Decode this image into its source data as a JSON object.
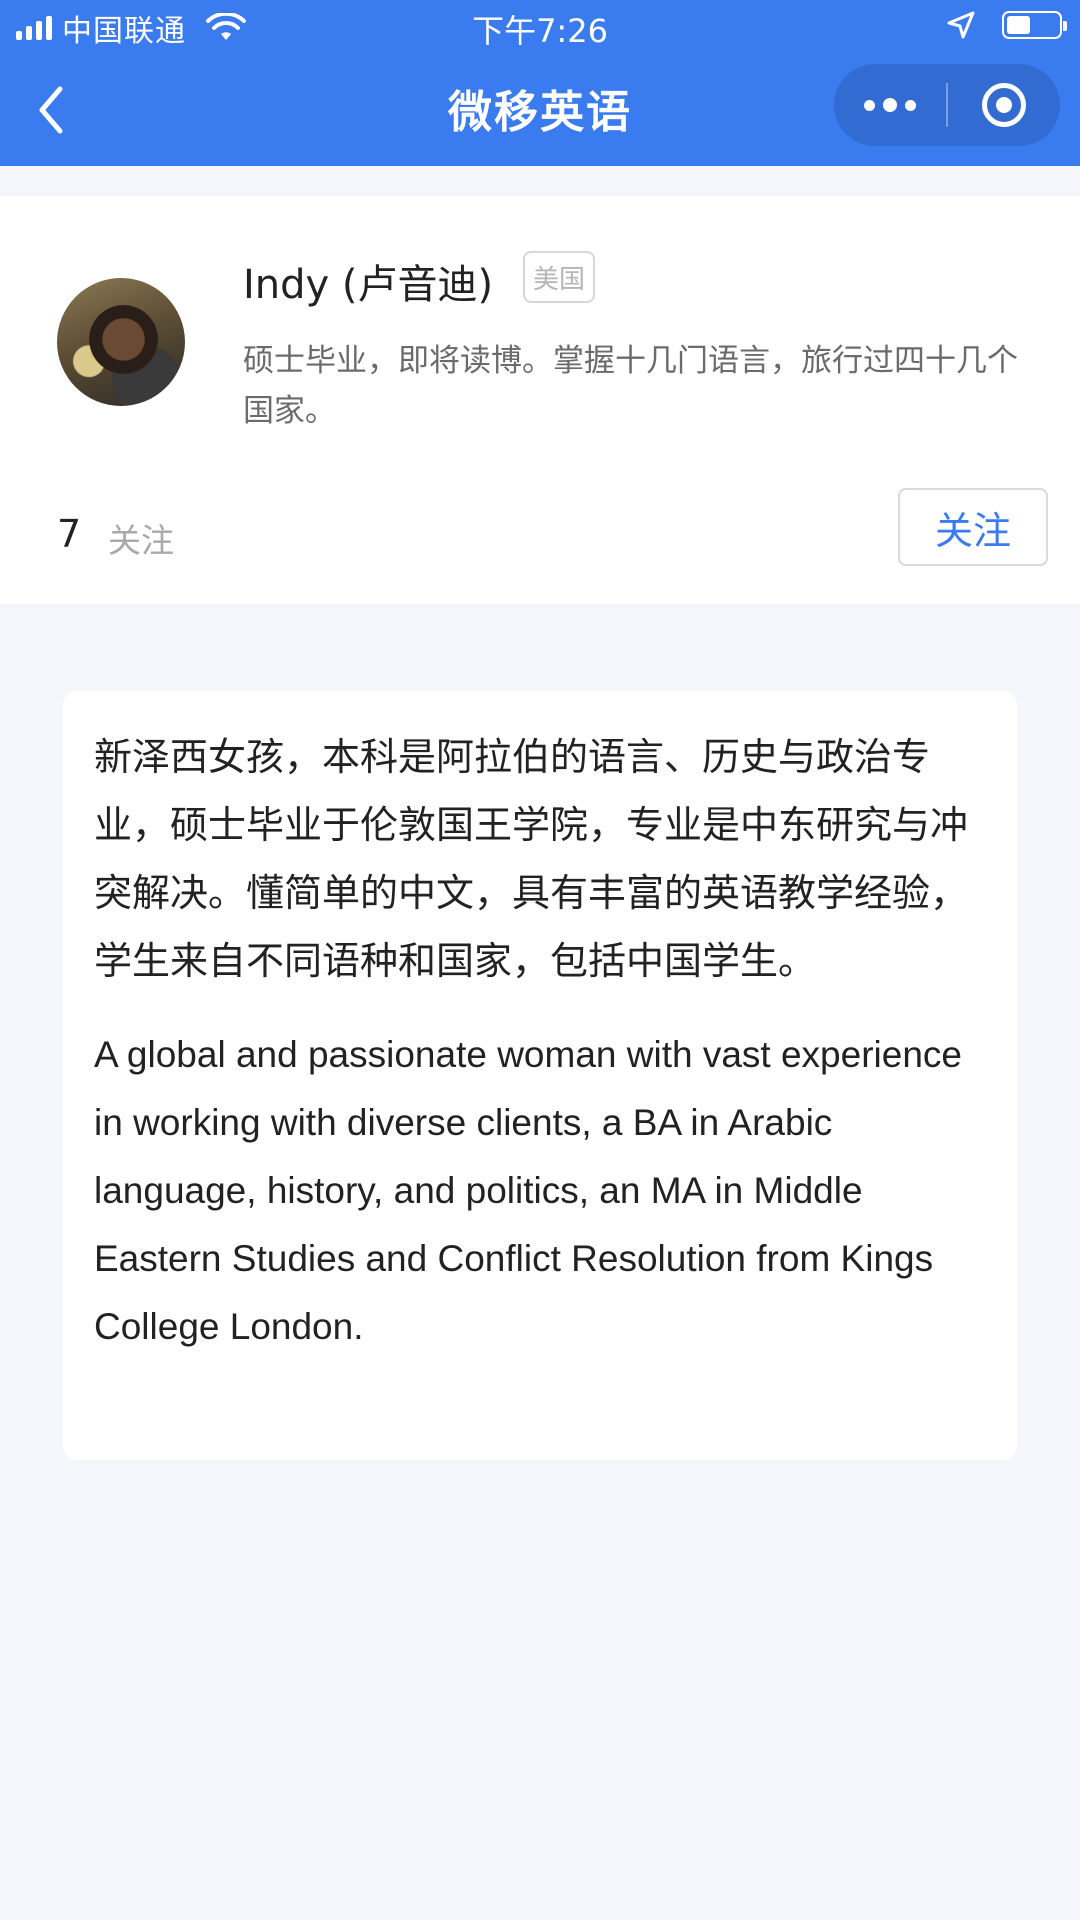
{
  "status_bar": {
    "carrier": "中国联通",
    "time": "下午7:26"
  },
  "nav": {
    "title": "微移英语"
  },
  "profile": {
    "name": "Indy (卢音迪)",
    "country": "美国",
    "headline": "硕士毕业，即将读博。掌握十几门语言，旅行过四十几个国家。",
    "follow_count": "7",
    "follow_label": "关注",
    "follow_button": "关注"
  },
  "bio": {
    "zh": "新泽西女孩，本科是阿拉伯的语言、历史与政治专业，硕士毕业于伦敦国王学院，专业是中东研究与冲突解决。懂简单的中文，具有丰富的英语教学经验，学生来自不同语种和国家，包括中国学生。",
    "en": "A global and passionate woman with vast experience in working with diverse clients, a BA in Arabic language, history, and politics, an MA in Middle Eastern Studies and Conflict Resolution from Kings College London."
  },
  "colors": {
    "brand_blue": "#3a7bef",
    "page_bg": "#f4f6fb"
  },
  "icons": [
    "signal-icon",
    "wifi-icon",
    "location-icon",
    "battery-icon",
    "back-arrow-icon",
    "more-icon",
    "close-miniprogram-icon"
  ]
}
